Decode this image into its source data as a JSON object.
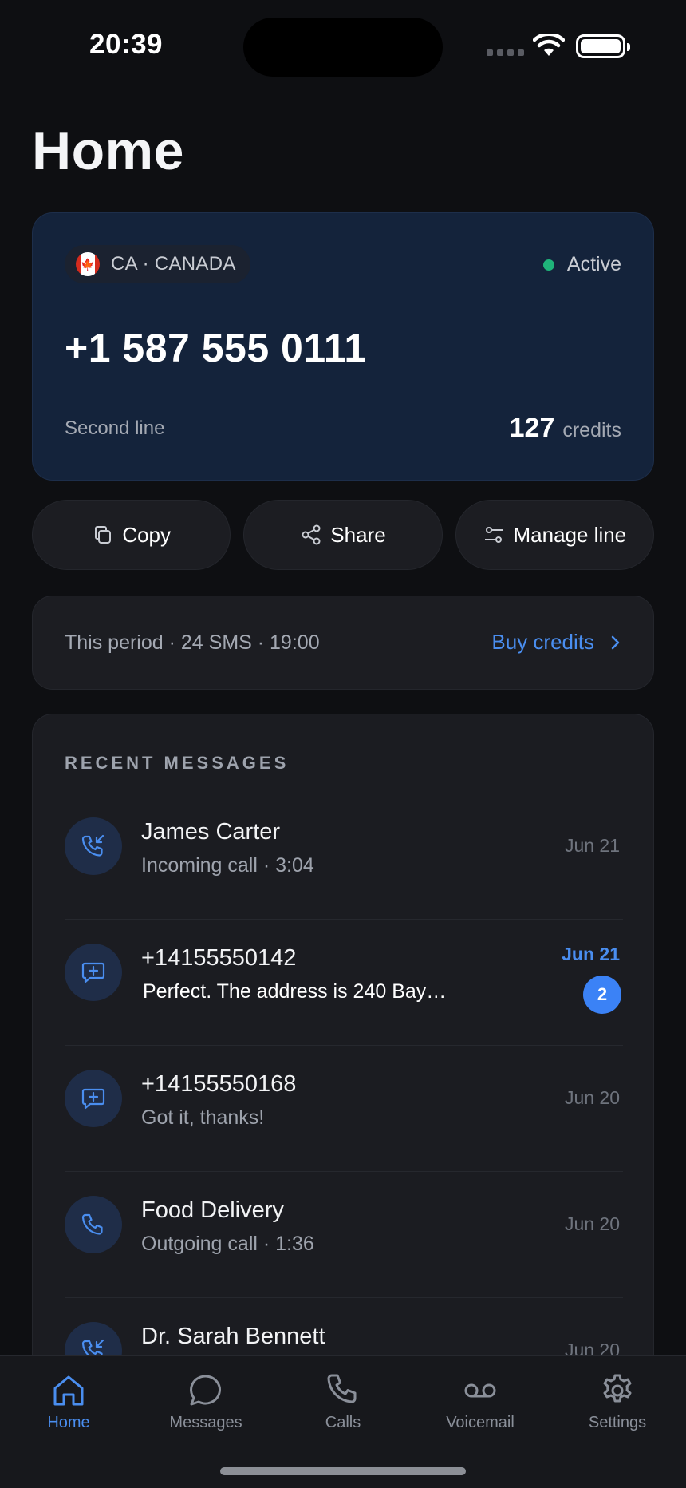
{
  "status_bar": {
    "time": "20:39"
  },
  "page": {
    "title": "Home"
  },
  "line_card": {
    "country": "CA · CANADA",
    "status": "Active",
    "status_color": "#1fb37a",
    "phone_number": "+1 587 555 0111",
    "line_label": "Second line",
    "credits_value": "127",
    "credits_unit": "credits"
  },
  "actions": {
    "copy": "Copy",
    "share": "Share",
    "manage": "Manage line"
  },
  "period": {
    "summary": "This period · 24 SMS · 19:00",
    "buy_label": "Buy credits"
  },
  "recent": {
    "title": "RECENT MESSAGES",
    "items": [
      {
        "name": "James Carter",
        "sub": "Incoming call · 3:04",
        "date": "Jun 21",
        "icon": "incoming-call-icon"
      },
      {
        "name": "+14155550142",
        "sub": "Perfect. The address is 240 Bay…",
        "date": "Jun 21",
        "badge": "2",
        "icon": "message-icon",
        "unread": true
      },
      {
        "name": "+14155550168",
        "sub": "Got it, thanks!",
        "date": "Jun 20",
        "icon": "message-icon"
      },
      {
        "name": "Food Delivery",
        "sub": "Outgoing call · 1:36",
        "date": "Jun 20",
        "icon": "phone-icon"
      },
      {
        "name": "Dr. Sarah Bennett",
        "sub": "",
        "date": "Jun 20",
        "icon": "incoming-call-icon"
      }
    ]
  },
  "tabs": {
    "home": "Home",
    "messages": "Messages",
    "calls": "Calls",
    "voicemail": "Voicemail",
    "settings": "Settings",
    "active_color": "#4a8ef0"
  }
}
